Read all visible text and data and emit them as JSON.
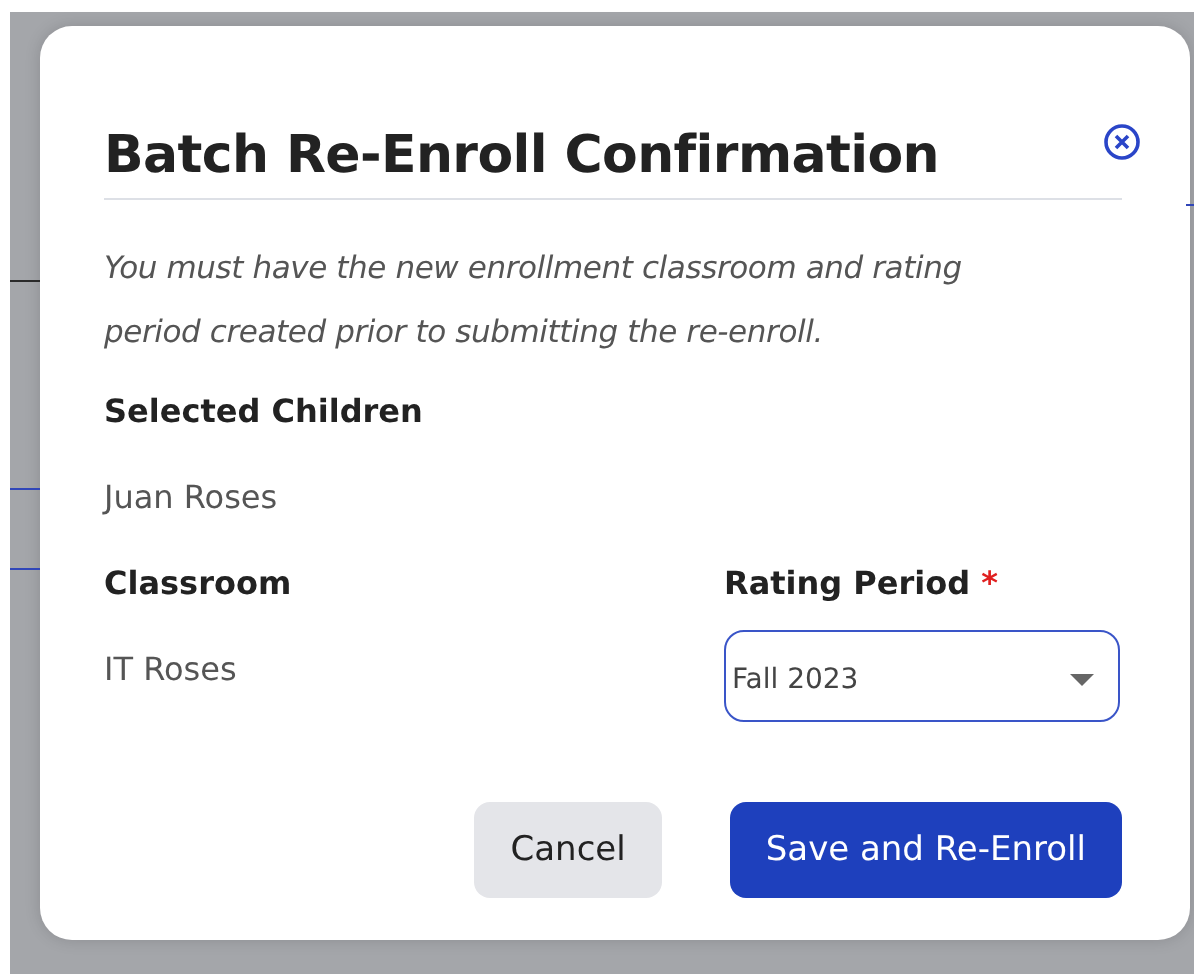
{
  "dialog": {
    "title": "Batch Re-Enroll Confirmation",
    "note": "You must have the new enrollment classroom and rating period created prior to submitting the re-enroll.",
    "selected_children": {
      "label": "Selected Children",
      "value": "Juan Roses"
    },
    "classroom": {
      "label": "Classroom",
      "value": "IT Roses"
    },
    "rating_period": {
      "label": "Rating Period",
      "required": true,
      "required_mark": "*",
      "value": "Fall 2023"
    },
    "buttons": [
      {
        "label": "Cancel",
        "kind": "secondary"
      },
      {
        "label": "Save and Re-Enroll",
        "kind": "primary"
      }
    ]
  }
}
